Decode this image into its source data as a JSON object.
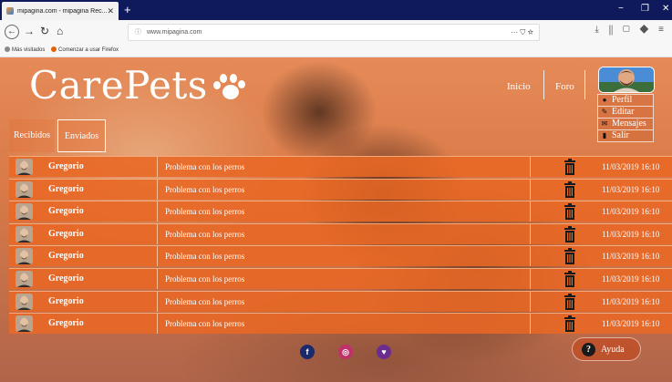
{
  "browser": {
    "tab_title": "mipagina.com - mipagina Rec...",
    "tab_close": "✕",
    "new_tab": "+",
    "window_controls": [
      "−",
      "❐",
      "✕"
    ],
    "url": "www.mipagina.com",
    "bookmarks": [
      "Más visitados",
      "Comenzar a usar Firefox"
    ]
  },
  "site": {
    "logo_text": "CarePets",
    "nav": [
      "Inicio",
      "Foro"
    ],
    "user_menu": [
      {
        "label": "Perfil",
        "icon": "person-icon"
      },
      {
        "label": "Editar",
        "icon": "pencil-icon"
      },
      {
        "label": "Mensajes",
        "icon": "envelope-icon"
      },
      {
        "label": "Salir",
        "icon": "door-icon"
      }
    ],
    "tabs": [
      "Recibidos",
      "Enviados"
    ],
    "help_label": "Ayuda"
  },
  "messages": [
    {
      "sender": "Gregorio",
      "subject": "Problema con los perros",
      "date": "11/03/2019  16:10"
    },
    {
      "sender": "Gregorio",
      "subject": "Problema con los perros",
      "date": "11/03/2019  16:10"
    },
    {
      "sender": "Gregorio",
      "subject": "Problema con los perros",
      "date": "11/03/2019  16:10"
    },
    {
      "sender": "Gregorio",
      "subject": "Problema con los perros",
      "date": "11/03/2019  16:10"
    },
    {
      "sender": "Gregorio",
      "subject": "Problema con los perros",
      "date": "11/03/2019  16:10"
    },
    {
      "sender": "Gregorio",
      "subject": "Problema con los perros",
      "date": "11/03/2019  16:10"
    },
    {
      "sender": "Gregorio",
      "subject": "Problema con los perros",
      "date": "11/03/2019  16:10"
    },
    {
      "sender": "Gregorio",
      "subject": "Problema con los perros",
      "date": "11/03/2019  16:10"
    }
  ],
  "social": [
    {
      "icon": "facebook-icon",
      "glyph": "f",
      "color": "#1b2a6b"
    },
    {
      "icon": "instagram-icon",
      "glyph": "◎",
      "color": "#c1306b"
    },
    {
      "icon": "twitter-icon",
      "glyph": "♥",
      "color": "#6a2d8f"
    }
  ],
  "colors": {
    "brand_orange": "#e86824",
    "row_orange": "#e86824",
    "browser_chrome": "#0f1a5c"
  }
}
